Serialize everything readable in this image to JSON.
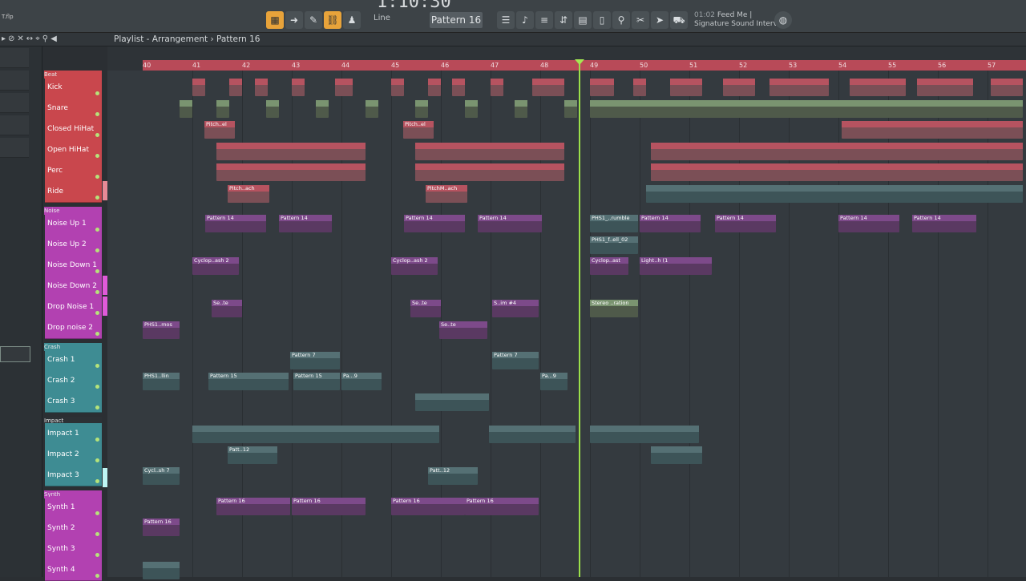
{
  "toolbar": {
    "time": "1:10:30",
    "pattern": "Pattern 16",
    "line_mode": "Line",
    "song_position": "01:02",
    "song_title": "Feed Me |",
    "song_subtitle": "Signature Sound Interview"
  },
  "titlebar": {
    "window_title": "Playlist - Arrangement",
    "separator": "›",
    "pattern": "Pattern 16"
  },
  "file_label": "T.flp",
  "ruler": [
    "40",
    "41",
    "42",
    "43",
    "44",
    "45",
    "46",
    "47",
    "48",
    "49",
    "50",
    "51",
    "52",
    "53",
    "54",
    "55",
    "56",
    "57"
  ],
  "groups": {
    "beat": "Beat",
    "noise": "Noise",
    "crash": "Crash",
    "impact": "Impact",
    "synth": "Synth"
  },
  "tracks": [
    {
      "name": "Kick",
      "color": "#c9474d"
    },
    {
      "name": "Snare",
      "color": "#c9474d"
    },
    {
      "name": "Closed HiHat",
      "color": "#c9474d"
    },
    {
      "name": "Open HiHat",
      "color": "#c9474d"
    },
    {
      "name": "Perc",
      "color": "#c9474d"
    },
    {
      "name": "Ride",
      "color": "#c9474d"
    },
    {
      "name": "Noise Up 1",
      "color": "#b241b1"
    },
    {
      "name": "Noise Up  2",
      "color": "#b241b1"
    },
    {
      "name": "Noise Down 1",
      "color": "#b241b1"
    },
    {
      "name": "Noise Down 2",
      "color": "#b241b1"
    },
    {
      "name": "Drop Noise 1",
      "color": "#b241b1"
    },
    {
      "name": "Drop noise 2",
      "color": "#b241b1"
    },
    {
      "name": "Crash 1",
      "color": "#3e8c93"
    },
    {
      "name": "Crash 2",
      "color": "#3e8c93"
    },
    {
      "name": "Crash 3",
      "color": "#3e8c93"
    },
    {
      "name": "Impact 1",
      "color": "#3e8c93"
    },
    {
      "name": "Impact 2",
      "color": "#3e8c93"
    },
    {
      "name": "Impact 3",
      "color": "#3e8c93"
    },
    {
      "name": "Synth 1",
      "color": "#b241b1"
    },
    {
      "name": "Synth 2",
      "color": "#b241b1"
    },
    {
      "name": "Synth 3",
      "color": "#b241b1"
    },
    {
      "name": "Synth 4",
      "color": "#b241b1"
    }
  ],
  "clips": {
    "closed_hihat_a": "Pitch..el",
    "closed_hihat_b": "Pitch..el",
    "ride_a": "Pitch..ach",
    "ride_b": "PitchM..ach",
    "noise_up_1_a": "Pattern 14",
    "noise_up_1_b": "Pattern 14",
    "noise_up_1_c": "Pattern 14",
    "noise_up_1_d": "Pattern 14",
    "noise_up_1_e": "PHS1_..rumble",
    "noise_up_1_f": "Pattern 14",
    "noise_up_1_g": "Pattern 14",
    "noise_up_1_h": "Pattern 14",
    "noise_up_1_i": "Pattern 14",
    "noise_up_2_a": "PHS1_f..ell_02",
    "noise_down_1_a": "Cyclop..ash 2",
    "noise_down_1_b": "Cyclop..ash 2",
    "noise_down_1_c": "Cyclop..ast",
    "noise_down_1_d": "Light..h (1",
    "drop_noise_1_a": "Se..te",
    "drop_noise_1_b": "Se..te",
    "drop_noise_1_c": "S..im #4",
    "drop_noise_1_d": "Stereo ..ration",
    "drop_noise_2_a": "PHS1..mos",
    "drop_noise_2_b": "Se..te",
    "crash_1_a": "Pattern 7",
    "crash_1_b": "Pattern 7",
    "crash_2_a": "PHS1..llin",
    "crash_2_b": "Pattern 15",
    "crash_2_c": "Pattern 15",
    "crash_2_d": "Pa...9",
    "crash_2_e": "Pa...9",
    "impact_2_a": "Patt..12",
    "impact_3_a": "Cycl..sh 7",
    "impact_3_b": "Patt..12",
    "synth_1_a": "Pattern 16",
    "synth_1_b": "Pattern 16",
    "synth_1_c": "Pattern 16",
    "synth_1_d": "Pattern 16",
    "synth_2_a": "Pattern 16"
  }
}
